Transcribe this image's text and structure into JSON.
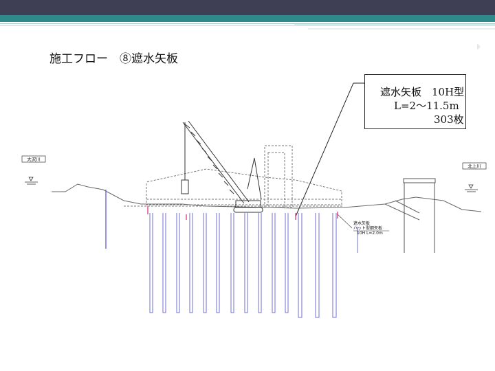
{
  "slide": {
    "title": "施工フロー　⑧遮水矢板",
    "accent_colors": {
      "top_bar": "#3e3f55",
      "band": "#2e8a8a",
      "pile": "#6f6fd6",
      "marker": "#e0508a"
    }
  },
  "callout": {
    "line1": "遮水矢板　10H型",
    "line2": "L=2～11.5m",
    "line3": "303枚"
  },
  "drawing": {
    "left_river_label": "大沢川",
    "right_river_label": "北上川",
    "annotation_lines": [
      "遮水矢板",
      "ハット型鋼矢板",
      "10H L=2.0m"
    ]
  }
}
